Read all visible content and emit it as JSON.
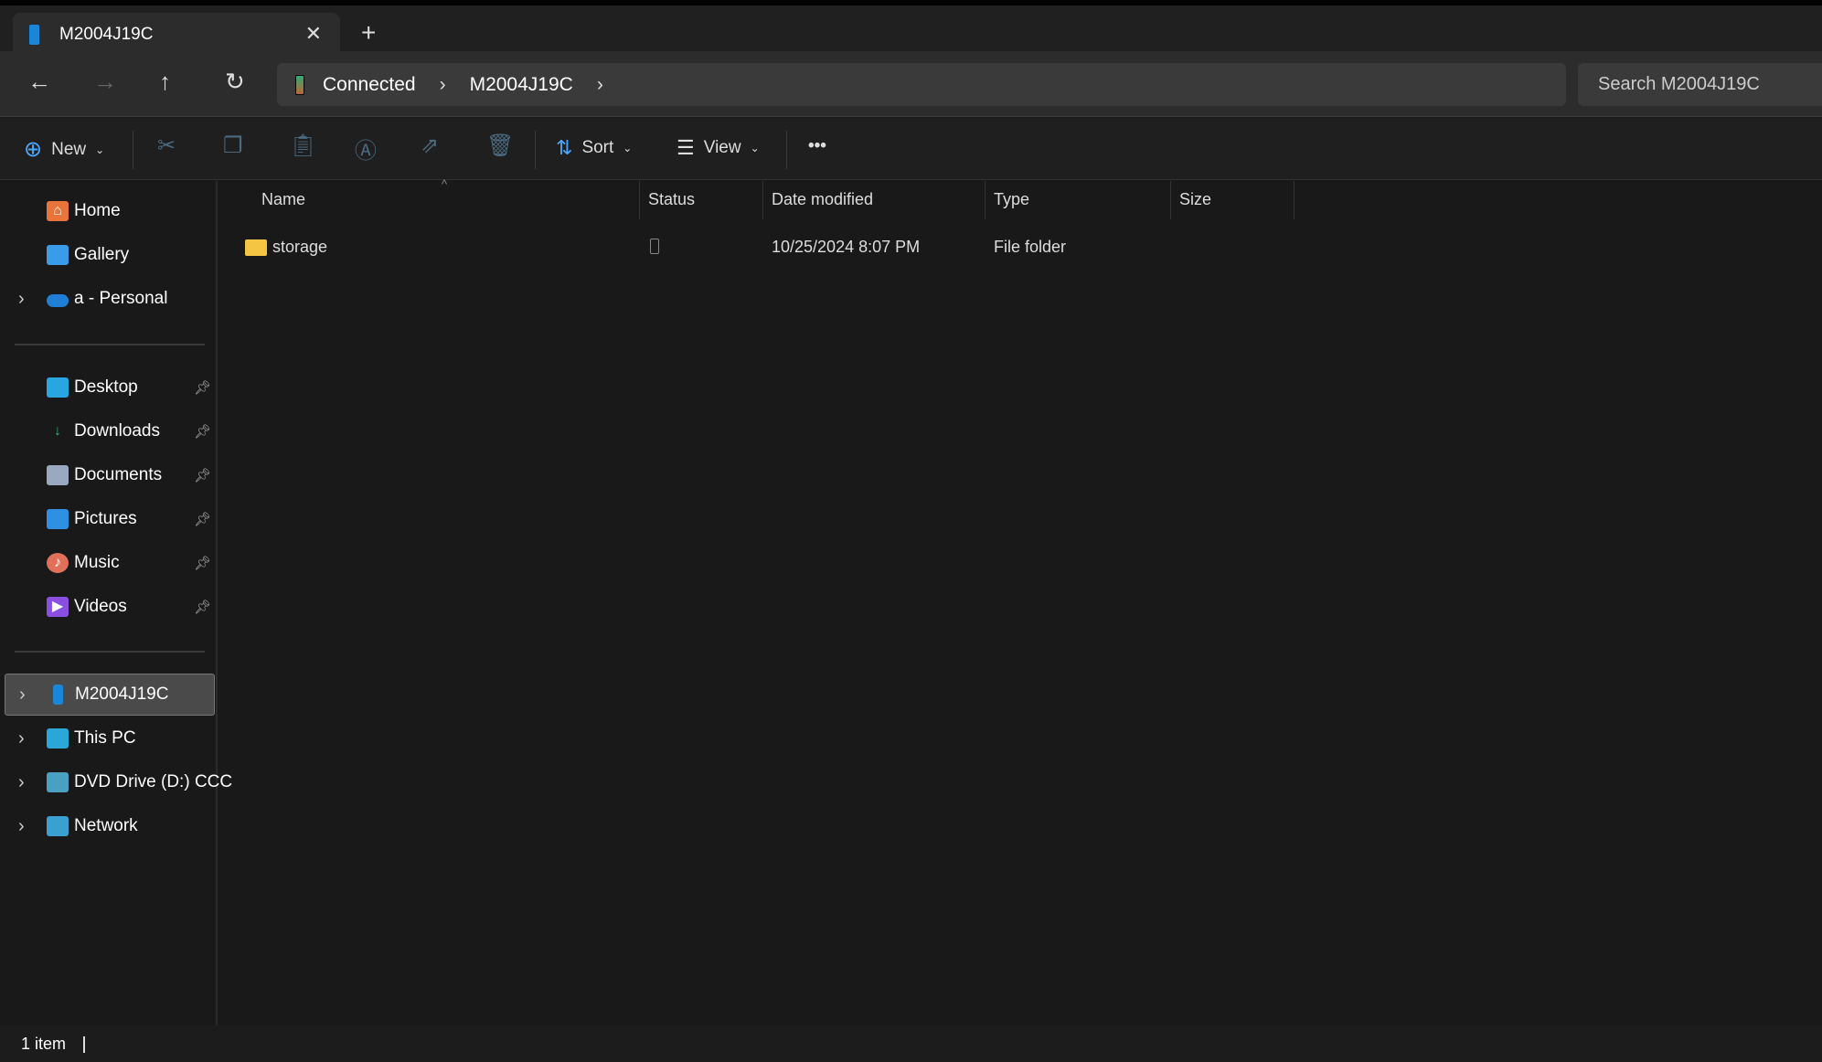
{
  "tab": {
    "title": "M2004J19C",
    "close_icon": "close-icon",
    "new_tab": "+"
  },
  "nav": {
    "breadcrumb": [
      "Connected",
      "M2004J19C"
    ],
    "search_placeholder": "Search M2004J19C"
  },
  "toolbar": {
    "new": "New",
    "sort": "Sort",
    "view": "View",
    "more": "•••"
  },
  "sidebar": {
    "quick": [
      {
        "label": "Home",
        "icon": "home-icon",
        "color": "#e8743b"
      },
      {
        "label": "Gallery",
        "icon": "gallery-icon",
        "color": "#3a9be8"
      },
      {
        "label": "a - Personal",
        "icon": "onedrive-icon",
        "color": "#1f7fd6",
        "expandable": true
      }
    ],
    "pinned": [
      {
        "label": "Desktop",
        "icon": "desktop-icon",
        "color": "#27a6e0"
      },
      {
        "label": "Downloads",
        "icon": "download-icon",
        "color": "#2bb673"
      },
      {
        "label": "Documents",
        "icon": "documents-icon",
        "color": "#9aa9bf"
      },
      {
        "label": "Pictures",
        "icon": "pictures-icon",
        "color": "#2f8fe0"
      },
      {
        "label": "Music",
        "icon": "music-icon",
        "color": "#e0705a"
      },
      {
        "label": "Videos",
        "icon": "videos-icon",
        "color": "#8a4ee0"
      }
    ],
    "devices": [
      {
        "label": "M2004J19C",
        "icon": "phone-icon",
        "color": "#1a86d8",
        "selected": true
      },
      {
        "label": "This PC",
        "icon": "pc-icon",
        "color": "#2aa6d8"
      },
      {
        "label": "DVD Drive (D:) CCC",
        "icon": "dvd-icon",
        "color": "#4aa0c0"
      },
      {
        "label": "Network",
        "icon": "network-icon",
        "color": "#3aa0d0"
      }
    ]
  },
  "columns": [
    "Name",
    "Status",
    "Date modified",
    "Type",
    "Size"
  ],
  "rows": [
    {
      "name": "storage",
      "date": "10/25/2024 8:07 PM",
      "type": "File folder",
      "size": ""
    }
  ],
  "status": {
    "count": "1 item"
  }
}
